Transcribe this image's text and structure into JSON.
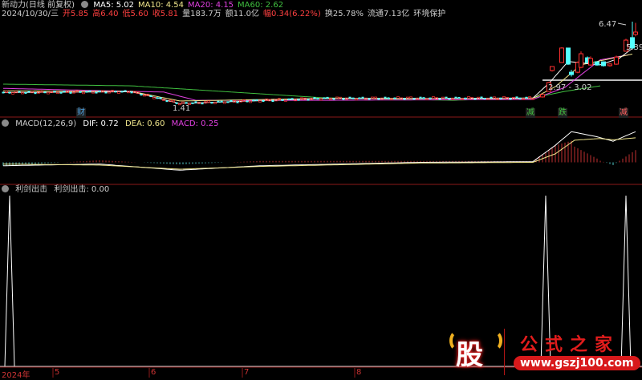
{
  "header": {
    "title": "新动力(日线 前复权)",
    "ma": [
      {
        "label": "MA5: 5.02",
        "color": "#ffffff"
      },
      {
        "label": "MA10: 4.54",
        "color": "#f0e68c"
      },
      {
        "label": "MA20: 4.15",
        "color": "#e040e0"
      },
      {
        "label": "MA60: 2.62",
        "color": "#40c040"
      }
    ],
    "quote": [
      {
        "text": "2024/10/30/三",
        "color": "#cccccc"
      },
      {
        "text": "开5.85",
        "color": "#ff4040"
      },
      {
        "text": "高6.40",
        "color": "#ff4040"
      },
      {
        "text": "低5.60",
        "color": "#ff4040"
      },
      {
        "text": "收5.81",
        "color": "#ff4040"
      },
      {
        "text": "量183.7万",
        "color": "#cccccc"
      },
      {
        "text": "额11.0亿",
        "color": "#cccccc"
      },
      {
        "text": "幅0.34(6.22%)",
        "color": "#ff4040"
      },
      {
        "text": "换25.78%",
        "color": "#cccccc"
      },
      {
        "text": "流通7.13亿",
        "color": "#cccccc"
      },
      {
        "text": "环境保护",
        "color": "#cccccc"
      }
    ]
  },
  "price_chart": {
    "price_range": [
      1.27,
      6.47
    ],
    "annotations": {
      "high": "6.47",
      "low": "1.41",
      "last": "5.39",
      "range": "2.97 - 3.02"
    },
    "range_line_price": 2.99,
    "ma60": [
      [
        0,
        2.75
      ],
      [
        40,
        2.65
      ],
      [
        100,
        1.94
      ],
      [
        140,
        1.79
      ],
      [
        165,
        1.94
      ],
      [
        175,
        2.32
      ],
      [
        186,
        2.65
      ]
    ],
    "ma20": [
      [
        0,
        2.5
      ],
      [
        50,
        2.28
      ],
      [
        60,
        1.79
      ],
      [
        100,
        1.79
      ],
      [
        165,
        1.84
      ],
      [
        175,
        2.56
      ],
      [
        186,
        4.2
      ],
      [
        195,
        4.5
      ]
    ],
    "ma10": [
      [
        0,
        2.35
      ],
      [
        40,
        2.32
      ],
      [
        55,
        1.75
      ],
      [
        100,
        1.9
      ],
      [
        165,
        1.9
      ],
      [
        172,
        2.6
      ],
      [
        180,
        3.9
      ],
      [
        190,
        4.3
      ],
      [
        196,
        4.54
      ]
    ],
    "ma5": [
      [
        0,
        2.25
      ],
      [
        40,
        2.3
      ],
      [
        55,
        1.6
      ],
      [
        100,
        1.9
      ],
      [
        165,
        1.92
      ],
      [
        170,
        2.8
      ],
      [
        176,
        4.1
      ],
      [
        186,
        3.9
      ],
      [
        192,
        4.3
      ],
      [
        197,
        5.02
      ]
    ],
    "candles": [
      [
        168,
        1.99,
        2.13,
        2.2,
        1.95
      ],
      [
        170,
        2.32,
        2.85,
        2.9,
        2.3
      ],
      [
        171,
        3.56,
        3.8,
        3.8,
        3.5
      ],
      [
        174,
        4.04,
        4.9,
        4.95,
        4.04
      ],
      [
        176,
        4.9,
        3.94,
        4.9,
        3.9
      ],
      [
        177,
        3.46,
        3.32,
        3.6,
        3.2
      ],
      [
        179,
        3.46,
        4.04,
        4.1,
        3.4
      ],
      [
        180,
        3.75,
        4.56,
        4.7,
        3.7
      ],
      [
        182,
        4.32,
        4.04,
        4.4,
        4.0
      ],
      [
        183,
        3.89,
        4.28,
        4.4,
        3.85
      ],
      [
        185,
        4.08,
        3.89,
        4.1,
        3.85
      ],
      [
        187,
        4.08,
        3.85,
        4.1,
        3.8
      ],
      [
        189,
        3.85,
        3.95,
        4.0,
        3.8
      ],
      [
        191,
        3.94,
        4.36,
        4.45,
        3.9
      ],
      [
        194,
        4.71,
        5.37,
        5.45,
        4.7
      ],
      [
        196,
        5.52,
        4.9,
        6.47,
        4.85
      ],
      [
        197,
        5.71,
        5.85,
        6.4,
        5.6
      ]
    ],
    "event_tags": [
      {
        "index": 24,
        "label": "财",
        "color": "#4aa0e0"
      },
      {
        "index": 164,
        "label": "减",
        "color": "#40c040"
      },
      {
        "index": 174,
        "label": "跌",
        "color": "#40c040"
      },
      {
        "index": 193,
        "label": "减",
        "color": "#ff6060"
      }
    ]
  },
  "macd": {
    "title": "MACD(12,26,9)",
    "dif_label": "DIF: 0.72",
    "dea_label": "DEA: 0.60",
    "macd_label": "MACD: 0.25",
    "value_range": [
      -0.6,
      1.0
    ],
    "dif": [
      [
        0,
        -0.1
      ],
      [
        30,
        -0.05
      ],
      [
        55,
        -0.23
      ],
      [
        80,
        -0.1
      ],
      [
        130,
        0.0
      ],
      [
        165,
        0.02
      ],
      [
        172,
        0.5
      ],
      [
        177,
        0.9
      ],
      [
        185,
        0.75
      ],
      [
        190,
        0.62
      ],
      [
        197,
        0.9
      ]
    ],
    "dea": [
      [
        0,
        -0.05
      ],
      [
        30,
        -0.08
      ],
      [
        55,
        -0.2
      ],
      [
        80,
        -0.12
      ],
      [
        130,
        -0.02
      ],
      [
        165,
        0.0
      ],
      [
        172,
        0.25
      ],
      [
        178,
        0.65
      ],
      [
        186,
        0.7
      ],
      [
        190,
        0.66
      ],
      [
        197,
        0.72
      ]
    ]
  },
  "indicator": {
    "title": "利剑出击",
    "value_label": "利剑出击: 0.00",
    "signals": [
      2,
      169,
      194
    ]
  },
  "time_axis": [
    {
      "index": 0,
      "label": "2024年"
    },
    {
      "index": 16,
      "label": "5"
    },
    {
      "index": 46,
      "label": "6"
    },
    {
      "index": 75,
      "label": "7"
    },
    {
      "index": 110,
      "label": "8"
    }
  ],
  "watermark": {
    "char": "股",
    "title": "公式之家",
    "url": "www.gszj100.com"
  }
}
